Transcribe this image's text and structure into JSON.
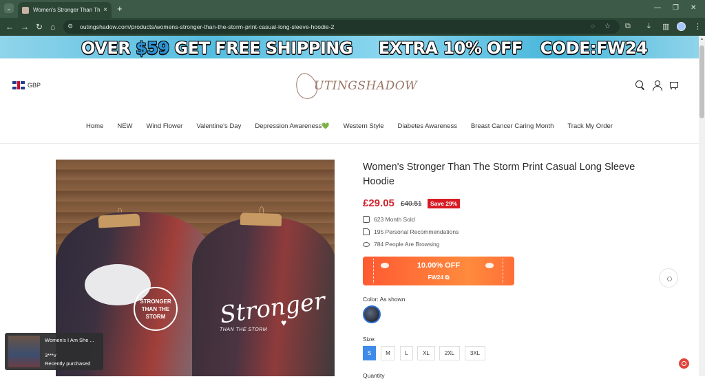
{
  "browser": {
    "tab_title": "Women's Stronger Than The St",
    "url": "outingshadow.com/products/womens-stronger-than-the-storm-print-casual-long-sleeve-hoodie-2",
    "new_tab": "+",
    "tab_close": "×",
    "tab_list": "⌄",
    "window_controls": {
      "minimize": "—",
      "restore": "❐",
      "close": "✕"
    },
    "nav_icons": {
      "back": "←",
      "forward": "→",
      "reload": "↻",
      "home": "⌂"
    }
  },
  "banner": {
    "part1": "OVER ",
    "amount": "$59",
    "part2": " GET FREE SHIPPING",
    "extra": "EXTRA 10% OFF",
    "code": "CODE:FW24"
  },
  "header": {
    "currency": "GBP",
    "logo_text": "UTINGSHADOW",
    "nav": [
      "Home",
      "NEW",
      "Wind Flower",
      "Valentine's Day",
      "Depression Awareness",
      "Western Style",
      "Diabetes Awareness",
      "Breast Cancer Caring Month",
      "Track My Order"
    ],
    "nav_heart": "💚"
  },
  "product": {
    "title": "Women's Stronger Than The Storm Print Casual Long Sleeve Hoodie",
    "price": "£29.05",
    "old_price": "£40.51",
    "save": "Save 29%",
    "stats": {
      "sold": "623 Month Sold",
      "recommendations": "195 Personal Recommendations",
      "browsing": "784 People Are Browsing"
    },
    "coupon": {
      "off": "10.00% OFF",
      "code": "FW24 ⧉"
    },
    "color_label": "Color: As shown",
    "size_label": "Size:",
    "sizes": [
      "S",
      "M",
      "L",
      "XL",
      "2XL",
      "3XL"
    ],
    "selected_size": "S",
    "qty_label": "Quantity",
    "image_print": {
      "badge": "STRONGER\nTHAN THE STORM",
      "script": "Stronger",
      "sub": "THAN THE STORM",
      "heart": "♥"
    }
  },
  "popup": {
    "product": "Women's I Am She ...",
    "user": "3***v",
    "status": "Recently purchased"
  },
  "colors": {
    "chrome": "#3c5a47",
    "price_red": "#d0262d",
    "coupon_orange": "#ff6e36",
    "size_selected": "#3f8bea"
  }
}
